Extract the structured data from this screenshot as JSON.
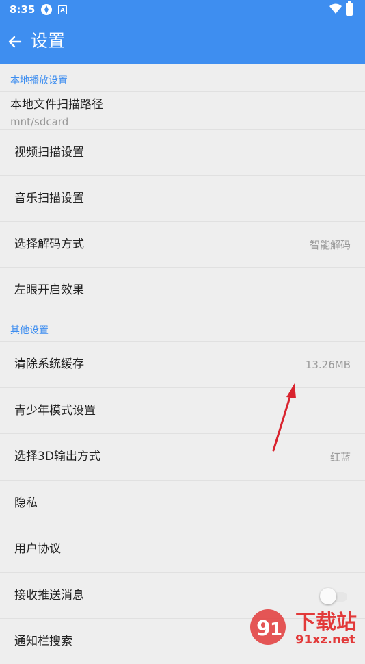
{
  "status_bar": {
    "time": "8:35",
    "icon_a": "A"
  },
  "app_bar": {
    "title": "设置"
  },
  "sections": [
    {
      "header": "本地播放设置"
    },
    {
      "header": "其他设置"
    }
  ],
  "local_path": {
    "label": "本地文件扫描路径",
    "value": "mnt/sdcard"
  },
  "rows": {
    "video_scan": {
      "label": "视频扫描设置"
    },
    "music_scan": {
      "label": "音乐扫描设置"
    },
    "decode": {
      "label": "选择解码方式",
      "value": "智能解码"
    },
    "left_eye": {
      "label": "左眼开启效果"
    },
    "clear_cache": {
      "label": "清除系统缓存",
      "value": "13.26MB"
    },
    "teen_mode": {
      "label": "青少年模式设置"
    },
    "output_3d": {
      "label": "选择3D输出方式",
      "value": "红蓝"
    },
    "privacy": {
      "label": "隐私"
    },
    "agreement": {
      "label": "用户协议"
    },
    "push": {
      "label": "接收推送消息",
      "enabled": false
    },
    "partial": {
      "label": "通知栏搜索"
    }
  },
  "watermark": {
    "brand": "下载站",
    "domain": "91xz.net"
  },
  "colors": {
    "accent": "#3e8ef0",
    "annotation_arrow": "#d9232e"
  }
}
